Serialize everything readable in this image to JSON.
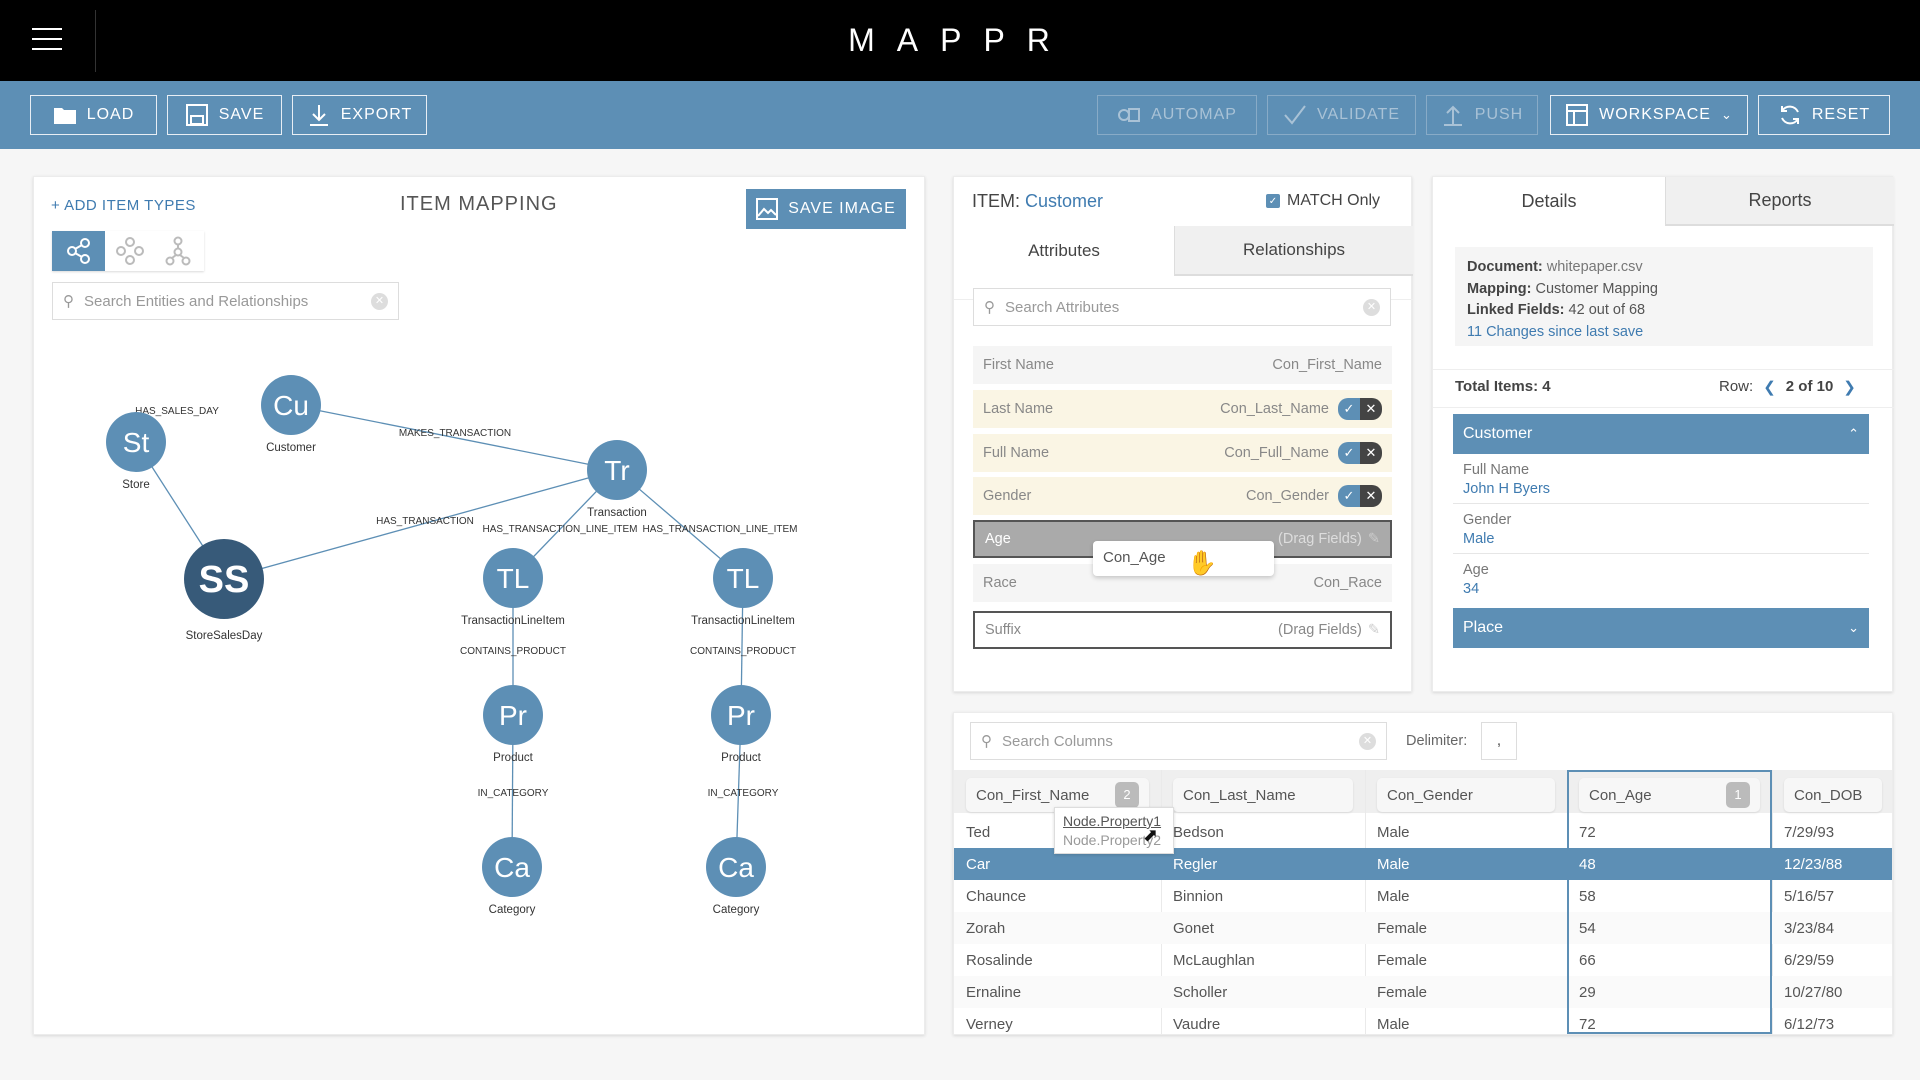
{
  "app": {
    "title": "MAPPR"
  },
  "toolbar": {
    "load": "LOAD",
    "save": "SAVE",
    "export": "EXPORT",
    "automap": "AUTOMAP",
    "validate": "VALIDATE",
    "push": "PUSH",
    "workspace": "WORKSPACE",
    "reset": "RESET"
  },
  "mapping": {
    "add_item_types": "+ ADD ITEM TYPES",
    "title": "ITEM MAPPING",
    "save_image": "SAVE IMAGE",
    "search_placeholder": "Search Entities and Relationships",
    "nodes": [
      {
        "id": "st",
        "abbr": "St",
        "label": "Store"
      },
      {
        "id": "cu",
        "abbr": "Cu",
        "label": "Customer"
      },
      {
        "id": "tr",
        "abbr": "Tr",
        "label": "Transaction"
      },
      {
        "id": "ss",
        "abbr": "SS",
        "label": "StoreSalesDay"
      },
      {
        "id": "tl1",
        "abbr": "TL",
        "label": "TransactionLineItem"
      },
      {
        "id": "tl2",
        "abbr": "TL",
        "label": "TransactionLineItem"
      },
      {
        "id": "pr1",
        "abbr": "Pr",
        "label": "Product"
      },
      {
        "id": "pr2",
        "abbr": "Pr",
        "label": "Product"
      },
      {
        "id": "ca1",
        "abbr": "Ca",
        "label": "Category"
      },
      {
        "id": "ca2",
        "abbr": "Ca",
        "label": "Category"
      }
    ],
    "edges": [
      {
        "from": "st",
        "to": "ss",
        "label": "HAS_SALES_DAY"
      },
      {
        "from": "cu",
        "to": "tr",
        "label": "MAKES_TRANSACTION"
      },
      {
        "from": "ss",
        "to": "tr",
        "label": "HAS_TRANSACTION"
      },
      {
        "from": "tr",
        "to": "tl1",
        "label": "HAS_TRANSACTION_LINE_ITEM"
      },
      {
        "from": "tr",
        "to": "tl2",
        "label": "HAS_TRANSACTION_LINE_ITEM"
      },
      {
        "from": "tl1",
        "to": "pr1",
        "label": "CONTAINS_PRODUCT"
      },
      {
        "from": "tl2",
        "to": "pr2",
        "label": "CONTAINS_PRODUCT"
      },
      {
        "from": "pr1",
        "to": "ca1",
        "label": "IN_CATEGORY"
      },
      {
        "from": "pr2",
        "to": "ca2",
        "label": "IN_CATEGORY"
      }
    ]
  },
  "item": {
    "prefix": "ITEM:",
    "name": "Customer",
    "match_only": "MATCH Only",
    "match_checked": true,
    "tabs": [
      "Attributes",
      "Relationships"
    ],
    "search_placeholder": "Search Attributes",
    "attributes": [
      {
        "name": "First Name",
        "value": "Con_First_Name",
        "state": "mapped"
      },
      {
        "name": "Last Name",
        "value": "Con_Last_Name",
        "state": "pending"
      },
      {
        "name": "Full Name",
        "value": "Con_Full_Name",
        "state": "pending"
      },
      {
        "name": "Gender",
        "value": "Con_Gender",
        "state": "pending"
      },
      {
        "name": "Age",
        "value": "(Drag Fields)",
        "state": "drop-target"
      },
      {
        "name": "Race",
        "value": "Con_Race",
        "state": "mapped"
      },
      {
        "name": "Suffix",
        "value": "(Drag Fields)",
        "state": "empty"
      }
    ],
    "drag_chip": "Con_Age"
  },
  "details": {
    "tabs": [
      "Details",
      "Reports"
    ],
    "document_label": "Document:",
    "document": "whitepaper.csv",
    "mapping_label": "Mapping:",
    "mapping": "Customer Mapping",
    "linked_label": "Linked Fields:",
    "linked": "42 out of 68",
    "changes": "11 Changes since last save",
    "total_items": "Total Items: 4",
    "row_label": "Row:",
    "row_value": "2 of 10",
    "sections": [
      {
        "title": "Customer",
        "expanded": true,
        "fields": [
          {
            "label": "Full Name",
            "value": "John H Byers"
          },
          {
            "label": "Gender",
            "value": "Male"
          },
          {
            "label": "Age",
            "value": "34"
          }
        ]
      },
      {
        "title": "Place",
        "expanded": false
      }
    ]
  },
  "columns": {
    "search_placeholder": "Search Columns",
    "delimiter_label": "Delimiter:",
    "delimiter": ",",
    "headers": [
      {
        "name": "Con_First_Name",
        "badge": "2"
      },
      {
        "name": "Con_Last_Name"
      },
      {
        "name": "Con_Gender"
      },
      {
        "name": "Con_Age",
        "badge": "1"
      },
      {
        "name": "Con_DOB"
      }
    ],
    "rows": [
      [
        "Ted",
        "Bedson",
        "Male",
        "72",
        "7/29/93"
      ],
      [
        "Car",
        "Regler",
        "Male",
        "48",
        "12/23/88"
      ],
      [
        "Chaunce",
        "Binnion",
        "Male",
        "58",
        "5/16/57"
      ],
      [
        "Zorah",
        "Gonet",
        "Female",
        "54",
        "3/23/84"
      ],
      [
        "Rosalinde",
        "McLaughlan",
        "Female",
        "66",
        "6/29/59"
      ],
      [
        "Ernaline",
        "Scholler",
        "Female",
        "29",
        "10/27/80"
      ],
      [
        "Verney",
        "Vaudre",
        "Male",
        "72",
        "6/12/73"
      ]
    ],
    "selected_row": 1,
    "tooltip": [
      "Node.Property1",
      "Node.Property2"
    ]
  },
  "colors": {
    "accent": "#5d8fb5",
    "dark_node": "#375a79",
    "link": "#3f7bb0"
  }
}
